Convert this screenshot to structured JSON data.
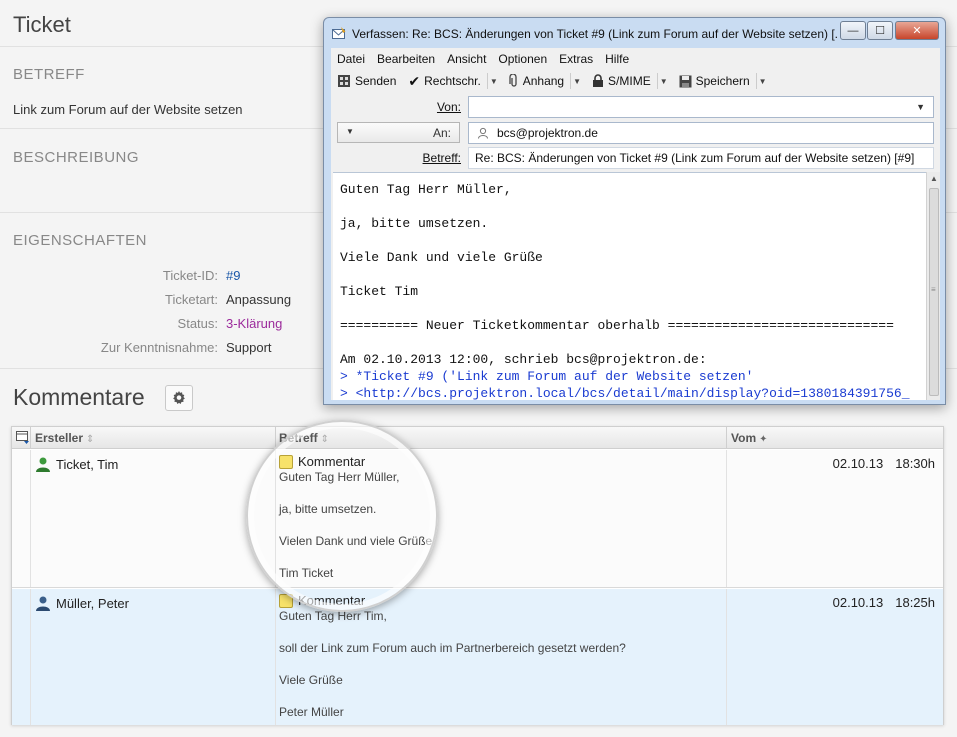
{
  "ticket": {
    "title": "Ticket",
    "betreff_heading": "BETREFF",
    "betreff_value": "Link zum Forum auf der Website setzen",
    "beschreibung_heading": "BESCHREIBUNG",
    "eigenschaften_heading": "EIGENSCHAFTEN",
    "props": [
      {
        "label": "Ticket-ID:",
        "value": "#9"
      },
      {
        "label": "Ticketart:",
        "value": "Anpassung"
      },
      {
        "label": "Status:",
        "value": "3-Klärung"
      },
      {
        "label": "Zur Kenntnisnahme:",
        "value": "Support"
      }
    ],
    "kommentare_heading": "Kommentare"
  },
  "table": {
    "columns": [
      "Ersteller",
      "Betreff",
      "Vom"
    ],
    "rows": [
      {
        "author": "Ticket, Tim",
        "subject": "Kommentar",
        "lines": [
          "Guten Tag Herr Müller,",
          "ja, bitte umsetzen.",
          "Vielen Dank und viele Grüße",
          "Tim Ticket"
        ],
        "date": "02.10.13",
        "time": "18:30h"
      },
      {
        "author": "Müller, Peter",
        "subject": "Kommentar",
        "lines": [
          "Guten Tag Herr Tim,",
          "soll der Link zum Forum auch im Partnerbereich gesetzt werden?",
          "Viele Grüße",
          "Peter Müller"
        ],
        "date": "02.10.13",
        "time": "18:25h"
      }
    ]
  },
  "compose": {
    "title": "Verfassen: Re: BCS: Änderungen von Ticket #9 (Link zum Forum auf der Website setzen) [...",
    "window_buttons": {
      "minimize": "—",
      "maximize": "☐",
      "close": "✕"
    },
    "menu": [
      "Datei",
      "Bearbeiten",
      "Ansicht",
      "Optionen",
      "Extras",
      "Hilfe"
    ],
    "toolbar": {
      "send": "Senden",
      "spell": "Rechtschr.",
      "attach": "Anhang",
      "smime": "S/MIME",
      "save": "Speichern"
    },
    "from_label": "Von:",
    "from_value": "",
    "to_label": "An:",
    "to_value": "bcs@projektron.de",
    "subject_label": "Betreff:",
    "subject_value": "Re: BCS: Änderungen von Ticket #9 (Link zum Forum auf der Website setzen) [#9]",
    "body": [
      "Guten Tag Herr Müller,",
      "ja, bitte umsetzen.",
      "Viele Dank und viele Grüße",
      "Ticket Tim",
      "========== Neuer Ticketkommentar oberhalb =============================",
      "Am 02.10.2013 12:00, schrieb bcs@projektron.de:"
    ],
    "quotes": [
      "> *Ticket #9 ('Link zum Forum auf der Website setzen'",
      "> <http://bcs.projektron.local/bcs/detail/main/display?oid=1380184391756_"
    ]
  }
}
